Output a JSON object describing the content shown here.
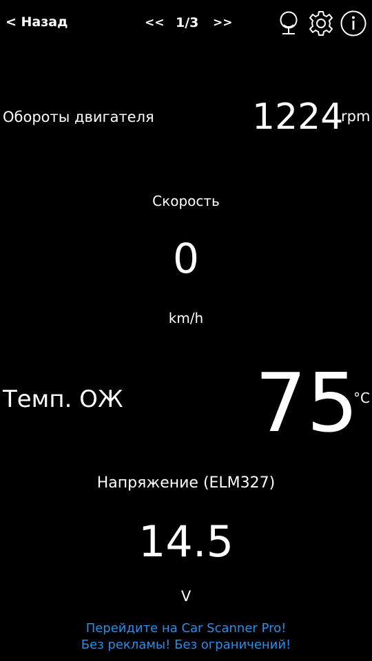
{
  "header": {
    "back_label": "< Назад",
    "prev_label": "<<",
    "page_indicator": "1/3",
    "next_label": ">>",
    "icons": [
      "microphone-icon",
      "gear-icon",
      "info-icon"
    ]
  },
  "gauges": {
    "rpm": {
      "label": "Обороты двигателя",
      "value": "1224",
      "unit": "rpm"
    },
    "speed": {
      "label": "Скорость",
      "value": "0",
      "unit": "km/h"
    },
    "coolant_temp": {
      "label": "Темп. ОЖ",
      "value": "75",
      "unit": "°C"
    },
    "voltage": {
      "label": "Напряжение (ELM327)",
      "value": "14.5",
      "unit": "V"
    }
  },
  "promo": {
    "line1": "Перейдите на Car Scanner Pro!",
    "line2": "Без рекламы! Без ограничений!"
  },
  "colors": {
    "background": "#000000",
    "text": "#ffffff",
    "promo_link": "#2b8de6"
  }
}
